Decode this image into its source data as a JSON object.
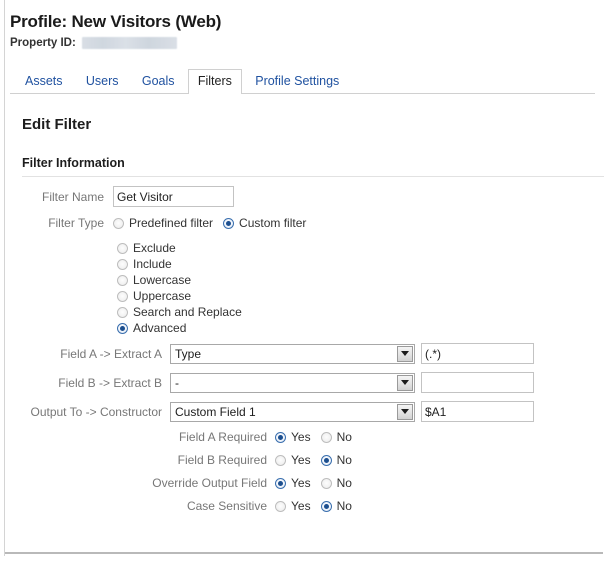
{
  "header": {
    "profile_title": "Profile: New Visitors (Web)",
    "property_label": "Property ID:",
    "property_value_redacted": ""
  },
  "tabs": [
    {
      "label": "Assets",
      "active": false
    },
    {
      "label": "Users",
      "active": false
    },
    {
      "label": "Goals",
      "active": false
    },
    {
      "label": "Filters",
      "active": true
    },
    {
      "label": "Profile Settings",
      "active": false
    }
  ],
  "main": {
    "section_title": "Edit Filter",
    "subsection_title": "Filter Information",
    "filter_name": {
      "label": "Filter Name",
      "value": "Get Visitor"
    },
    "filter_type": {
      "label": "Filter Type",
      "options": [
        {
          "label": "Predefined filter",
          "selected": false
        },
        {
          "label": "Custom filter",
          "selected": true
        }
      ]
    },
    "custom_types": [
      {
        "label": "Exclude",
        "selected": false
      },
      {
        "label": "Include",
        "selected": false
      },
      {
        "label": "Lowercase",
        "selected": false
      },
      {
        "label": "Uppercase",
        "selected": false
      },
      {
        "label": "Search and Replace",
        "selected": false
      },
      {
        "label": "Advanced",
        "selected": true
      }
    ],
    "advanced_rows": [
      {
        "label": "Field A -> Extract A",
        "select_value": "Type",
        "text_value": "(.*)"
      },
      {
        "label": "Field B -> Extract B",
        "select_value": "-",
        "text_value": ""
      },
      {
        "label": "Output To -> Constructor",
        "select_value": "Custom Field 1",
        "text_value": "$A1"
      }
    ],
    "yes_no_rows": [
      {
        "label": "Field A Required",
        "yes_label": "Yes",
        "no_label": "No",
        "value": "Yes"
      },
      {
        "label": "Field B Required",
        "yes_label": "Yes",
        "no_label": "No",
        "value": "No"
      },
      {
        "label": "Override Output Field",
        "yes_label": "Yes",
        "no_label": "No",
        "value": "Yes"
      },
      {
        "label": "Case Sensitive",
        "yes_label": "Yes",
        "no_label": "No",
        "value": "No"
      }
    ]
  },
  "colors": {
    "tab_link": "#2052a0",
    "label_gray": "#777777",
    "radio_accent": "#1c4f8f",
    "rule": "#e2e2e2"
  }
}
